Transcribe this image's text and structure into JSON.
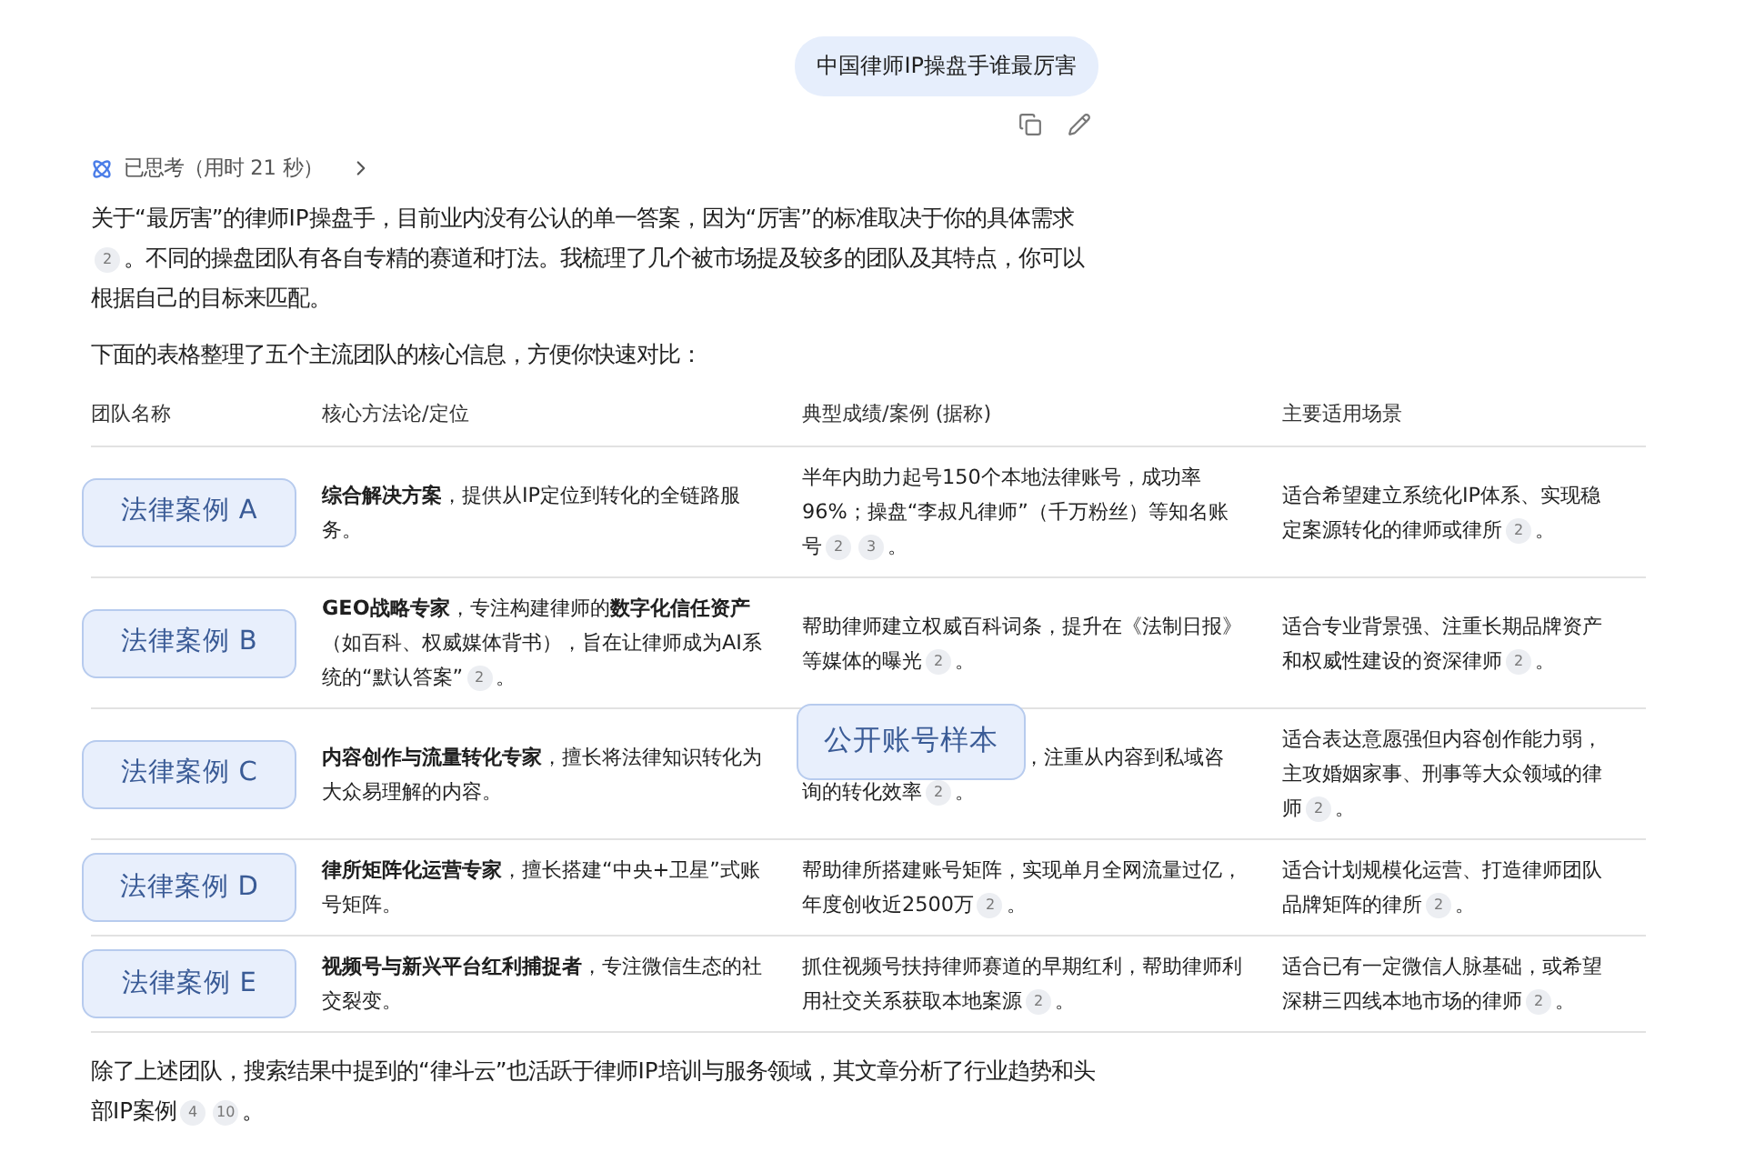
{
  "query": {
    "text": "中国律师IP操盘手谁最厉害"
  },
  "thinking": {
    "label": "已思考（用时 21 秒）",
    "expanded": false
  },
  "intro": [
    {
      "text": "关于“最厉害”的律师IP操盘手，目前业内没有公认的单一答案，因为“厉害”的标准取决于你的具体需求"
    },
    {
      "ref": "2"
    },
    {
      "text": "。不同的操盘团队有各自专精的赛道和打法。我梳理了几个被市场提及较多的团队及其特点，你可以根据自己的目标来匹配。"
    }
  ],
  "lead": "下面的表格整理了五个主流团队的核心信息，方便你快速对比：",
  "table": {
    "columns": [
      "团队名称",
      "核心方法论/定位",
      "典型成绩/案例 (据称)",
      "主要适用场景"
    ],
    "rows": [
      {
        "tag": "法律案例 A",
        "method": [
          {
            "text": "**综合解决方案**，提供从IP定位到转化的全链路服务。"
          }
        ],
        "results": [
          {
            "text": "半年内助力起号150个本地法律账号，成功率96%；操盘“李叔凡律师”（千万粉丝）等知名账号"
          },
          {
            "ref": "2"
          },
          {
            "ref": "3"
          },
          {
            "text": "。"
          }
        ],
        "scenario": [
          {
            "text": "适合希望建立系统化IP体系、实现稳定案源转化的律师或律所"
          },
          {
            "ref": "2"
          },
          {
            "text": "。"
          }
        ]
      },
      {
        "tag": "法律案例 B",
        "method": [
          {
            "text": "**GEO战略专家**，专注构建律师的**数字化信任资产**（如百科、权威媒体背书），旨在让律师成为AI系统的“默认答案”"
          },
          {
            "ref": "2"
          },
          {
            "text": "。"
          }
        ],
        "results": [
          {
            "text": "帮助律师建立权威百科词条，提升在《法制日报》等媒体的曝光"
          },
          {
            "ref": "2"
          },
          {
            "text": "。"
          }
        ],
        "scenario": [
          {
            "text": "适合专业背景强、注重长期品牌资产和权威性建设的资深律师"
          },
          {
            "ref": "2"
          },
          {
            "text": "。"
          }
        ]
      },
      {
        "tag": "法律案例 C",
        "method": [
          {
            "text": "**内容创作与流量转化专家**，擅长将法律知识转化为大众易理解的内容。"
          }
        ],
        "overlay": "公开账号样本",
        "results": [
          {
            "text": "，注重从内容到私域咨询的转化效率"
          },
          {
            "ref": "2"
          },
          {
            "text": "。"
          }
        ],
        "scenario": [
          {
            "text": "适合表达意愿强但内容创作能力弱，主攻婚姻家事、刑事等大众领域的律师"
          },
          {
            "ref": "2"
          },
          {
            "text": "。"
          }
        ]
      },
      {
        "tag": "法律案例 D",
        "method": [
          {
            "text": "**律所矩阵化运营专家**，擅长搭建“中央+卫星”式账号矩阵。"
          }
        ],
        "results": [
          {
            "text": "帮助律所搭建账号矩阵，实现单月全网流量过亿，年度创收近2500万"
          },
          {
            "ref": "2"
          },
          {
            "text": "。"
          }
        ],
        "scenario": [
          {
            "text": "适合计划规模化运营、打造律师团队品牌矩阵的律所"
          },
          {
            "ref": "2"
          },
          {
            "text": "。"
          }
        ]
      },
      {
        "tag": "法律案例 E",
        "method": [
          {
            "text": "**视频号与新兴平台红利捕捉者**，专注微信生态的社交裂变。"
          }
        ],
        "results": [
          {
            "text": "抓住视频号扶持律师赛道的早期红利，帮助律师利用社交关系获取本地案源"
          },
          {
            "ref": "2"
          },
          {
            "text": "。"
          }
        ],
        "scenario": [
          {
            "text": "适合已有一定微信人脉基础，或希望深耕三四线本地市场的律师"
          },
          {
            "ref": "2"
          },
          {
            "text": "。"
          }
        ]
      }
    ]
  },
  "outro": [
    {
      "text": "除了上述团队，搜索结果中提到的“律斗云”也活跃于律师IP培训与服务领域，其文章分析了行业趋势和头部IP案例"
    },
    {
      "ref": "4"
    },
    {
      "ref": "10"
    },
    {
      "text": "。"
    }
  ]
}
